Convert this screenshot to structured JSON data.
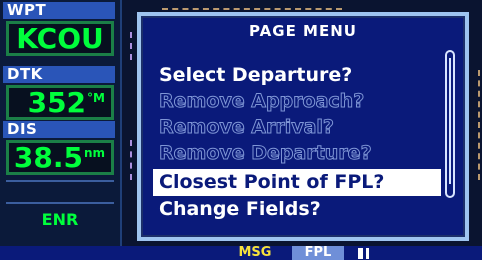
{
  "left_panel": {
    "waypoint": {
      "label": "WPT",
      "value": "KCOU"
    },
    "desired_track": {
      "label": "DTK",
      "value": "352",
      "unit": "°M"
    },
    "distance": {
      "label": "DIS",
      "value": "38.5",
      "unit": "nm"
    },
    "mode": "ENR"
  },
  "page_menu": {
    "title": "PAGE MENU",
    "items": [
      {
        "label": "Select Departure?",
        "state": "enabled"
      },
      {
        "label": "Remove Approach?",
        "state": "disabled"
      },
      {
        "label": "Remove Arrival?",
        "state": "disabled"
      },
      {
        "label": "Remove Departure?",
        "state": "disabled"
      },
      {
        "label": "Closest Point of FPL?",
        "state": "selected"
      },
      {
        "label": "Change Fields?",
        "state": "enabled"
      }
    ]
  },
  "status_bar": {
    "msg": "MSG",
    "page": "FPL"
  },
  "colors": {
    "data_green": "#00ff3c",
    "label_blue": "#2a55b8",
    "menu_bg": "#0a1a7a",
    "msg_yellow": "#f6e23b"
  }
}
